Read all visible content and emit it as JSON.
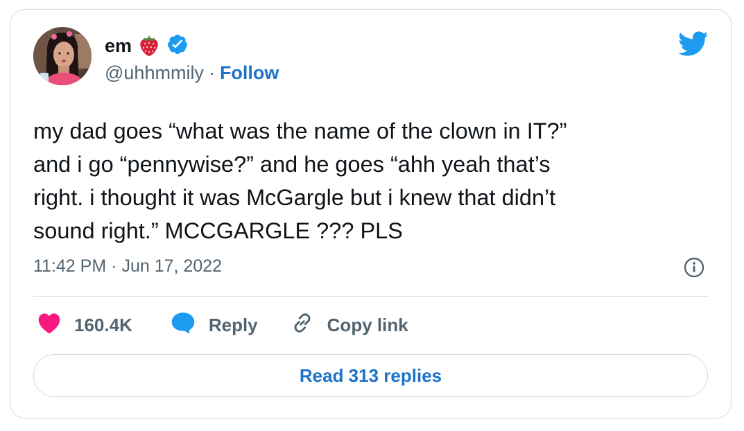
{
  "author": {
    "display_name": "em",
    "name_emoji": "strawberry",
    "verified": true,
    "handle": "@uhhmmily",
    "separator": "·",
    "follow_label": "Follow"
  },
  "tweet": {
    "text": "my dad goes “what was the name of the clown in IT?”\nand i go “pennywise?” and he goes “ahh yeah that’s\nright. i thought it was McGargle but i knew that didn’t\nsound right.” MCCGARGLE ??? PLS",
    "time": "11:42 PM",
    "separator": "·",
    "date": "Jun 17, 2022"
  },
  "actions": {
    "like_count": "160.4K",
    "reply_label": "Reply",
    "copy_link_label": "Copy link"
  },
  "read_replies_label": "Read 313 replies",
  "colors": {
    "brand_blue": "#1d9bf0",
    "link_blue": "#1d73c9",
    "like_pink": "#f91880",
    "text": "#0f1419",
    "secondary_text": "#536471",
    "border": "#cfd9de"
  },
  "icons": [
    "avatar",
    "strawberry-icon",
    "verified-badge-icon",
    "twitter-bird-icon",
    "info-icon",
    "heart-icon",
    "reply-bubble-icon",
    "link-icon"
  ]
}
